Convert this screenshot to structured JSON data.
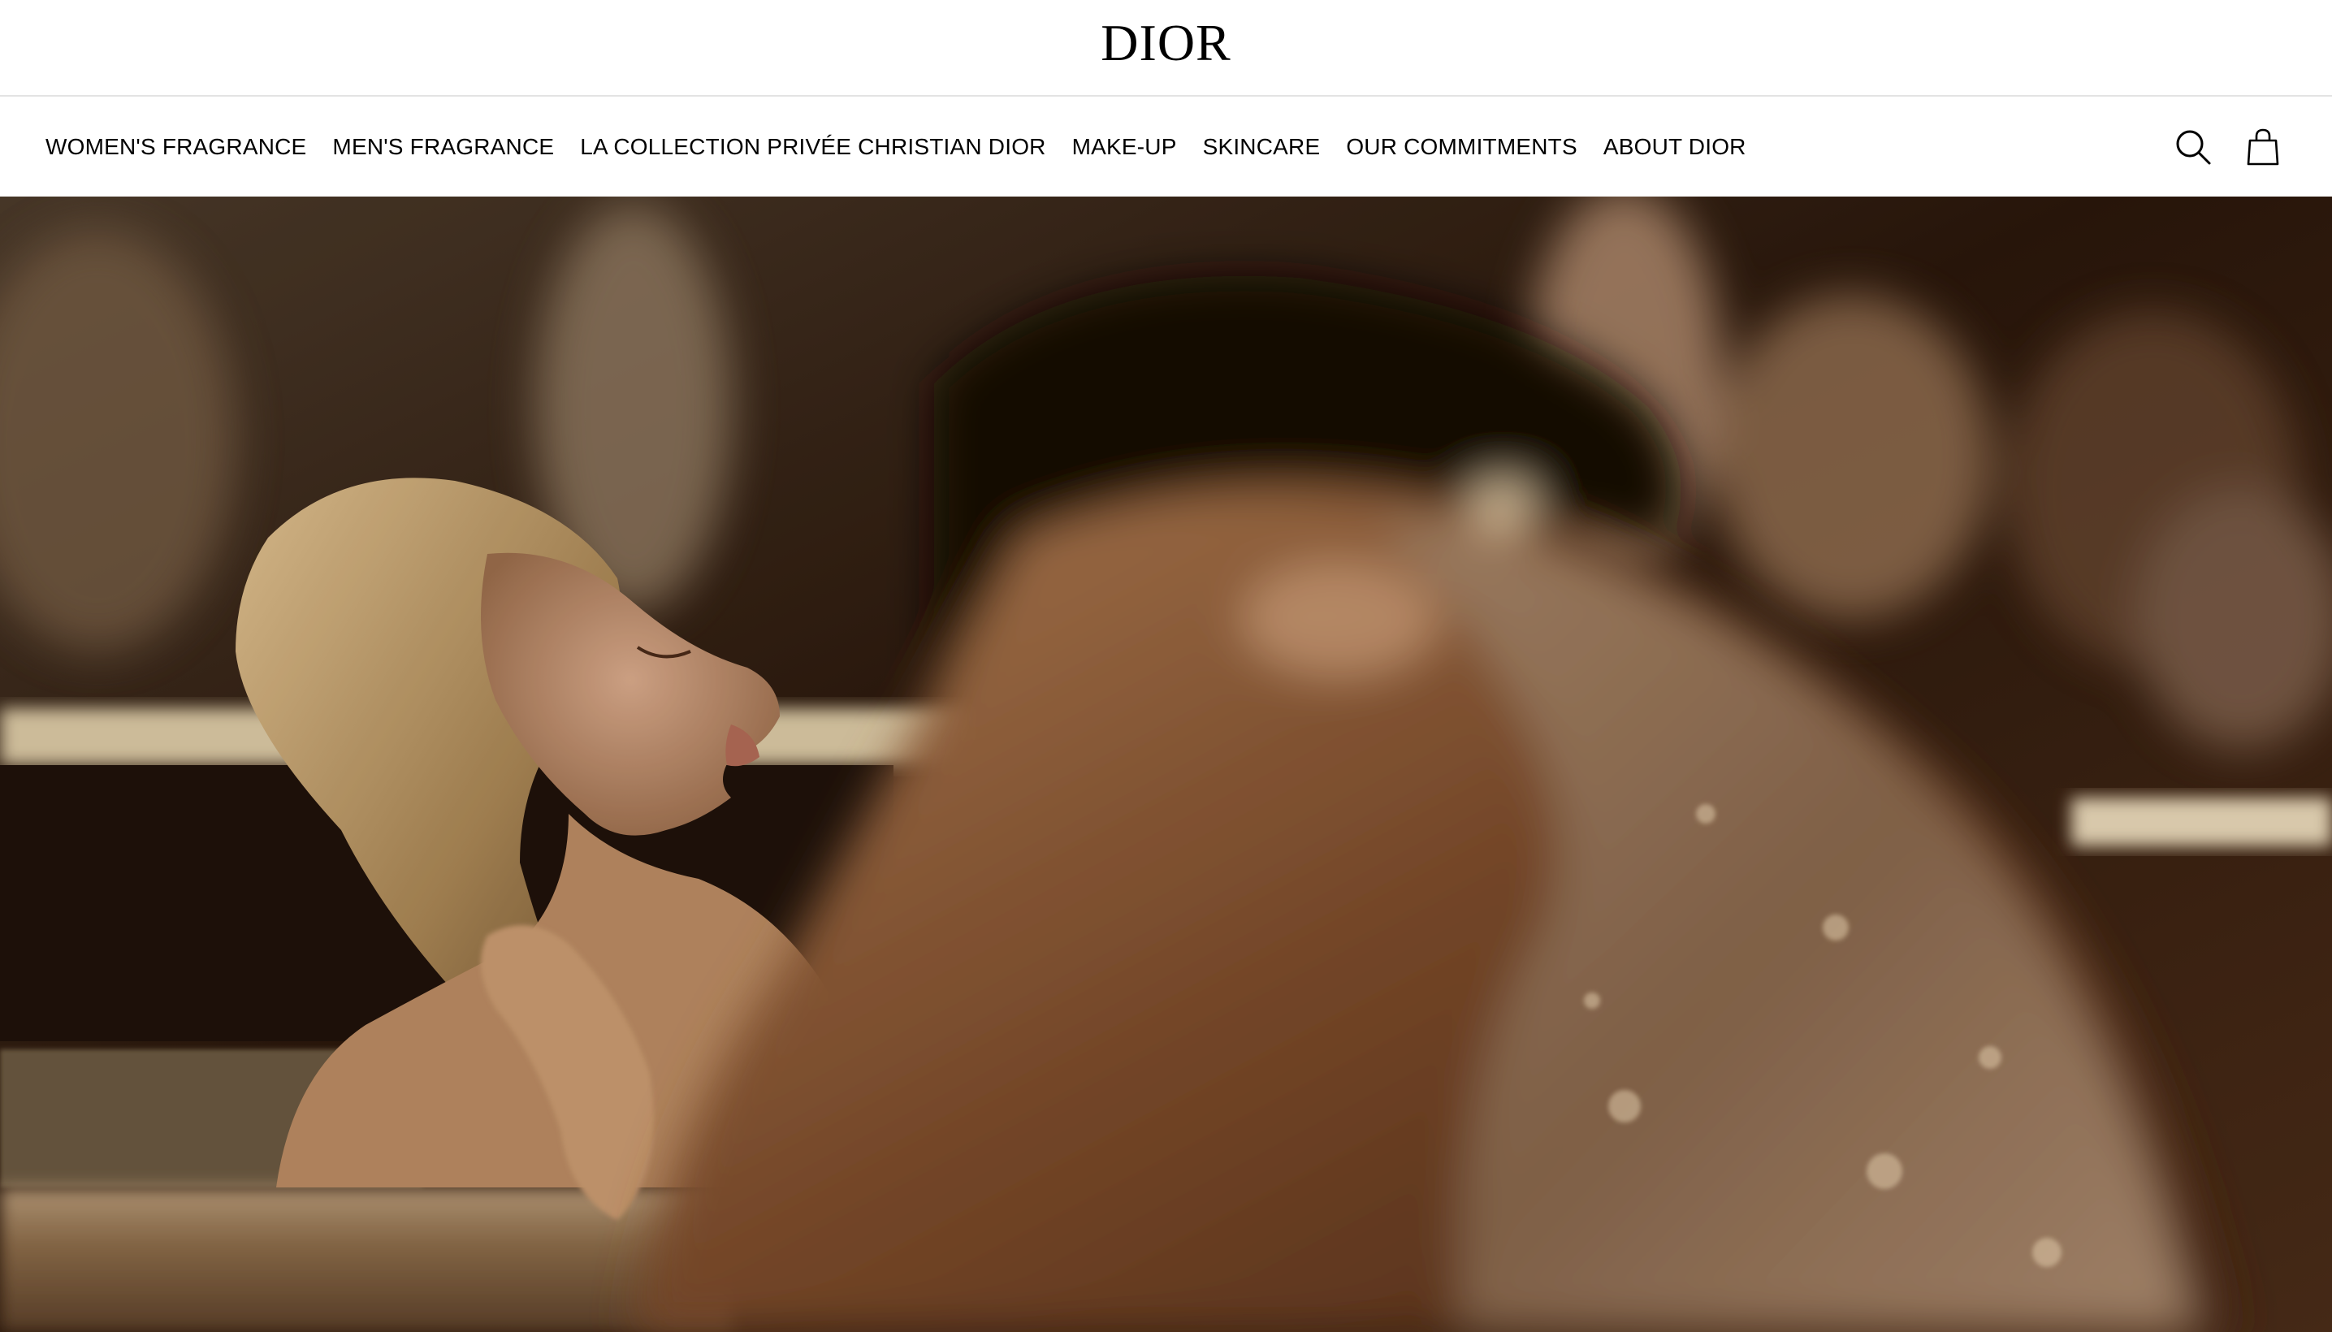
{
  "header": {
    "logo_text": "DIOR"
  },
  "nav": {
    "items": [
      {
        "label": "WOMEN'S FRAGRANCE"
      },
      {
        "label": "MEN'S FRAGRANCE"
      },
      {
        "label": "LA COLLECTION PRIVÉE CHRISTIAN DIOR"
      },
      {
        "label": "MAKE-UP"
      },
      {
        "label": "SKINCARE"
      },
      {
        "label": "OUR COMMITMENTS"
      },
      {
        "label": "ABOUT DIOR"
      }
    ],
    "actions": [
      {
        "icon": "search-icon"
      },
      {
        "icon": "shopping-bag-icon"
      }
    ]
  },
  "hero": {
    "media": "campaign-video-still",
    "colors": {
      "dark": "#2a170b",
      "bronze": "#8a5a35",
      "gold": "#c9a36f",
      "skin": "#a3704a"
    }
  }
}
